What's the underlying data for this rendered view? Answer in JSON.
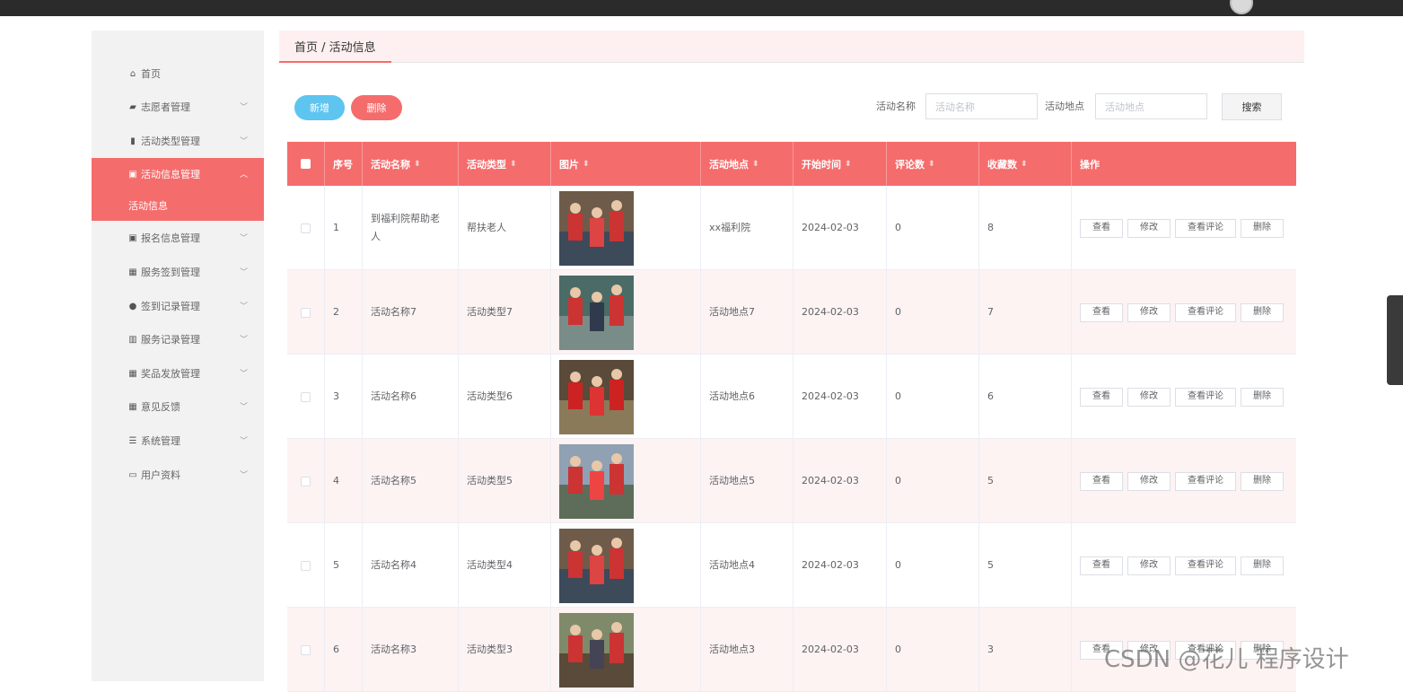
{
  "breadcrumb": "首页 / 活动信息",
  "sidebar": {
    "items": [
      {
        "label": "首页",
        "icon": "home-icon",
        "has_chevron": false
      },
      {
        "label": "志愿者管理",
        "icon": "chart-line-icon",
        "has_chevron": true
      },
      {
        "label": "活动类型管理",
        "icon": "bar-chart-icon",
        "has_chevron": true
      },
      {
        "label": "活动信息管理",
        "icon": "clipboard-icon",
        "has_chevron": true,
        "active": true
      },
      {
        "label": "报名信息管理",
        "icon": "clipboard-x-icon",
        "has_chevron": true
      },
      {
        "label": "服务签到管理",
        "icon": "grid-icon",
        "has_chevron": true
      },
      {
        "label": "签到记录管理",
        "icon": "user-icon",
        "has_chevron": true
      },
      {
        "label": "服务记录管理",
        "icon": "stats-icon",
        "has_chevron": true
      },
      {
        "label": "奖品发放管理",
        "icon": "grid-icon",
        "has_chevron": true
      },
      {
        "label": "意见反馈",
        "icon": "grid-icon",
        "has_chevron": true
      },
      {
        "label": "系统管理",
        "icon": "list-icon",
        "has_chevron": true
      },
      {
        "label": "用户资料",
        "icon": "window-icon",
        "has_chevron": true
      }
    ],
    "submenu_active": "活动信息"
  },
  "toolbar": {
    "add_label": "新增",
    "delete_label": "删除",
    "name_label": "活动名称",
    "name_placeholder": "活动名称",
    "location_label": "活动地点",
    "location_placeholder": "活动地点",
    "search_label": "搜索"
  },
  "table": {
    "headers": {
      "index": "序号",
      "name": "活动名称",
      "type": "活动类型",
      "image": "图片",
      "location": "活动地点",
      "start": "开始时间",
      "comments": "评论数",
      "favorites": "收藏数",
      "actions": "操作"
    },
    "action_labels": {
      "view": "查看",
      "edit": "修改",
      "view_comments": "查看评论",
      "delete": "删除"
    },
    "rows": [
      {
        "index": "1",
        "name": "到福利院帮助老人",
        "type": "帮扶老人",
        "location": "xx福利院",
        "start": "2024-02-03",
        "comments": "0",
        "favorites": "8"
      },
      {
        "index": "2",
        "name": "活动名称7",
        "type": "活动类型7",
        "location": "活动地点7",
        "start": "2024-02-03",
        "comments": "0",
        "favorites": "7"
      },
      {
        "index": "3",
        "name": "活动名称6",
        "type": "活动类型6",
        "location": "活动地点6",
        "start": "2024-02-03",
        "comments": "0",
        "favorites": "6"
      },
      {
        "index": "4",
        "name": "活动名称5",
        "type": "活动类型5",
        "location": "活动地点5",
        "start": "2024-02-03",
        "comments": "0",
        "favorites": "5"
      },
      {
        "index": "5",
        "name": "活动名称4",
        "type": "活动类型4",
        "location": "活动地点4",
        "start": "2024-02-03",
        "comments": "0",
        "favorites": "5"
      },
      {
        "index": "6",
        "name": "活动名称3",
        "type": "活动类型3",
        "location": "活动地点3",
        "start": "2024-02-03",
        "comments": "0",
        "favorites": "3"
      }
    ]
  },
  "watermark": "CSDN @花儿  程序设计",
  "colors": {
    "accent": "#f56c6c",
    "add_button": "#5ec4f0",
    "sidebar_bg": "#f2f2f3",
    "header_bar": "#2b2b2b"
  }
}
